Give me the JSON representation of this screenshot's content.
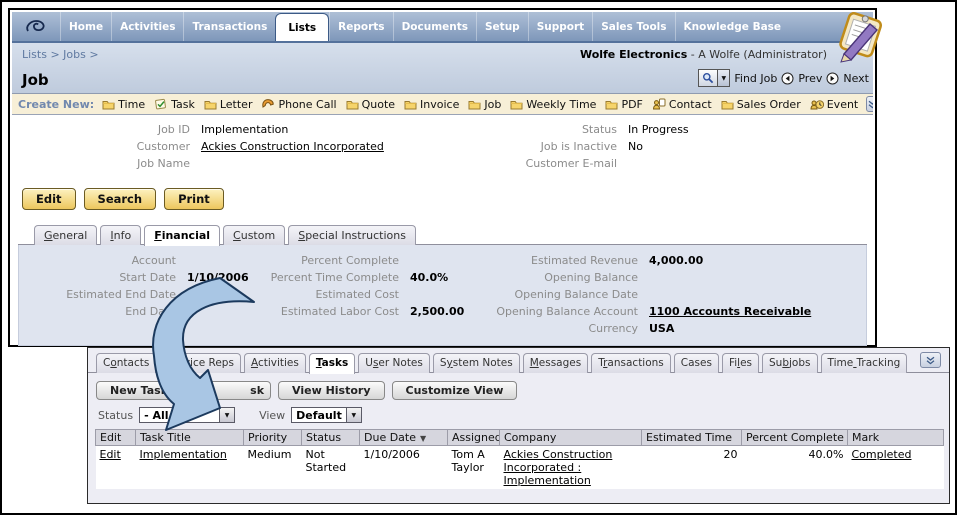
{
  "colors": {
    "nav_blue": "#7e97ba",
    "active_tab": "#ffffff",
    "create_bar_cream": "#f7efd7",
    "tan_button": "#edc75e",
    "financial_panel_blue": "#dfe4ef",
    "sublist_panel_lavender": "#ededf4",
    "callout_arrow_blue": "#a9c6e4",
    "header_band_blue": "#c6d1e1"
  },
  "window": {
    "nav": {
      "logo_icon": "swirl-logo-icon",
      "tabs": [
        {
          "label": "Home"
        },
        {
          "label": "Activities"
        },
        {
          "label": "Transactions"
        },
        {
          "label": "Lists",
          "active": true
        },
        {
          "label": "Reports"
        },
        {
          "label": "Documents"
        },
        {
          "label": "Setup"
        },
        {
          "label": "Support"
        },
        {
          "label": "Sales Tools"
        },
        {
          "label": "Knowledge Base"
        }
      ]
    },
    "header": {
      "breadcrumb": "Lists > Jobs >",
      "company": "Wolfe Electronics",
      "user": " - A Wolfe (Administrator)",
      "page_title": "Job",
      "find_label": "Find Job",
      "prev_label": "Prev",
      "next_label": "Next"
    },
    "create_new": {
      "label": "Create New:",
      "items": [
        {
          "label": "Time",
          "icon": "folder-icon"
        },
        {
          "label": "Task",
          "icon": "task-icon"
        },
        {
          "label": "Letter",
          "icon": "folder-icon"
        },
        {
          "label": "Phone Call",
          "icon": "phone-icon"
        },
        {
          "label": "Quote",
          "icon": "folder-icon"
        },
        {
          "label": "Invoice",
          "icon": "folder-icon"
        },
        {
          "label": "Job",
          "icon": "folder-icon"
        },
        {
          "label": "Weekly Time",
          "icon": "folder-icon"
        },
        {
          "label": "PDF",
          "icon": "folder-icon"
        },
        {
          "label": "Contact",
          "icon": "contact-icon"
        },
        {
          "label": "Sales Order",
          "icon": "folder-icon"
        },
        {
          "label": "Event",
          "icon": "event-icon"
        }
      ]
    },
    "record": {
      "fields_left": [
        {
          "label": "Job ID",
          "value": "Implementation"
        },
        {
          "label": "Customer",
          "value": "Ackies Construction Incorporated",
          "link": true
        },
        {
          "label": "Job Name",
          "value": ""
        }
      ],
      "fields_right": [
        {
          "label": "Status",
          "value": "In Progress"
        },
        {
          "label": "Job is Inactive",
          "value": "No"
        },
        {
          "label": "Customer E-mail",
          "value": ""
        }
      ],
      "buttons": [
        "Edit",
        "Search",
        "Print"
      ]
    },
    "record_tabs": [
      {
        "label": "General",
        "u": 0
      },
      {
        "label": "Info",
        "u": 0
      },
      {
        "label": "Financial",
        "u": 0,
        "active": true
      },
      {
        "label": "Custom",
        "u": 0
      },
      {
        "label": "Special Instructions",
        "u": 0
      }
    ],
    "financial": {
      "col1": [
        {
          "label": "Account",
          "value": ""
        },
        {
          "label": "Start Date",
          "value": "1/10/2006"
        },
        {
          "label": "Estimated End Date",
          "value": ""
        },
        {
          "label": "End Date",
          "value": ""
        }
      ],
      "col2": [
        {
          "label": "Percent Complete",
          "value": ""
        },
        {
          "label": "Percent Time Complete",
          "value": "40.0%"
        },
        {
          "label": "Estimated Cost",
          "value": ""
        },
        {
          "label": "Estimated Labor Cost",
          "value": "2,500.00"
        }
      ],
      "col3": [
        {
          "label": "Estimated Revenue",
          "value": "4,000.00"
        },
        {
          "label": "Opening Balance",
          "value": ""
        },
        {
          "label": "Opening Balance Date",
          "value": ""
        },
        {
          "label": "Opening Balance Account",
          "value": "1100 Accounts Receivable",
          "link": true
        },
        {
          "label": "Currency",
          "value": "USA"
        }
      ]
    }
  },
  "panel": {
    "tabs": [
      {
        "label": "Contacts",
        "u": 1
      },
      {
        "label": "Service Reps",
        "u": 1
      },
      {
        "label": "Activities",
        "u": 0
      },
      {
        "label": "Tasks",
        "u": 0,
        "active": true
      },
      {
        "label": "User Notes",
        "u": 1
      },
      {
        "label": "System Notes",
        "u": 1
      },
      {
        "label": "Messages",
        "u": 0
      },
      {
        "label": "Transactions",
        "u": 1
      },
      {
        "label": "Cases"
      },
      {
        "label": "Files",
        "u": 2
      },
      {
        "label": "Subjobs",
        "u": 2
      },
      {
        "label": "Time Tracking",
        "u": 4
      }
    ],
    "buttons": [
      {
        "label": "New Task"
      },
      {
        "label": "sk",
        "covered": true
      },
      {
        "label": "View History"
      },
      {
        "label": "Customize View"
      }
    ],
    "filters": {
      "status_label": "Status",
      "status_value": "- All -",
      "view_label": "View",
      "view_value": "Default"
    },
    "table": {
      "headers": [
        "Edit",
        "Task Title",
        "Priority",
        "Status",
        "Due Date",
        "Assigned To",
        "Company",
        "Estimated Time",
        "Percent Complete",
        "Mark"
      ],
      "sort_column": "Due Date",
      "sort_dir": "desc",
      "rows": [
        {
          "edit": "Edit",
          "task_title": "Implementation",
          "priority": "Medium",
          "status": "Not Started",
          "due_date": "1/10/2006",
          "assigned_to": "Tom A Taylor",
          "company": "Ackies Construction Incorporated : Implementation",
          "estimated_time": "20",
          "percent_complete": "40.0%",
          "mark": "Completed"
        }
      ]
    }
  }
}
